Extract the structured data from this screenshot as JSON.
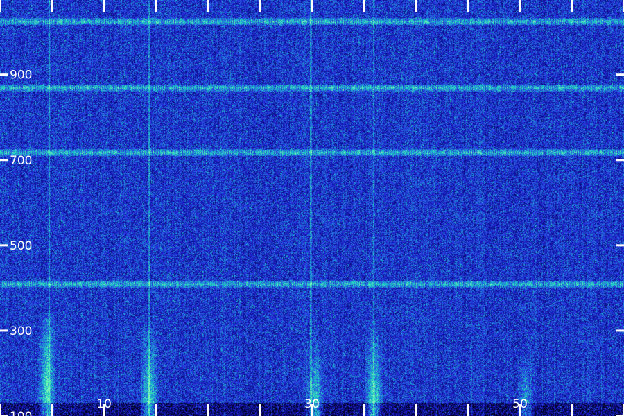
{
  "chart_data": {
    "type": "heatmap",
    "title": "",
    "xlabel": "",
    "ylabel": "",
    "xlim": [
      0,
      60
    ],
    "ylim": [
      100,
      1075
    ],
    "x_ticks": [
      0,
      5,
      10,
      15,
      20,
      25,
      30,
      35,
      40,
      45,
      50,
      55,
      60
    ],
    "x_tick_labels": [
      {
        "x": 10,
        "text": "10"
      },
      {
        "x": 30,
        "text": "30"
      },
      {
        "x": 50,
        "text": "50"
      }
    ],
    "y_ticks": [
      100,
      300,
      500,
      700,
      900
    ],
    "y_tick_labels": [
      {
        "y": 100,
        "text": "100"
      },
      {
        "y": 300,
        "text": "300"
      },
      {
        "y": 500,
        "text": "500"
      },
      {
        "y": 700,
        "text": "700"
      },
      {
        "y": 900,
        "text": "900"
      }
    ],
    "horizontal_bands_y": [
      1025,
      870,
      718,
      410
    ],
    "vertical_lines_x": [
      4.7,
      14.3,
      29.9,
      35.9
    ],
    "bursts": [
      {
        "x": 4.5,
        "y_top": 380
      },
      {
        "x": 14.3,
        "y_top": 330
      },
      {
        "x": 30.3,
        "y_top": 300
      },
      {
        "x": 35.9,
        "y_top": 330
      },
      {
        "x": 50.5,
        "y_top": 250
      }
    ],
    "colormap": [
      "#000010",
      "#0c0c96",
      "#2a34e6",
      "#1e9bd2",
      "#21dcbe",
      "#8cffb4"
    ],
    "grid": false,
    "legend": "none"
  }
}
